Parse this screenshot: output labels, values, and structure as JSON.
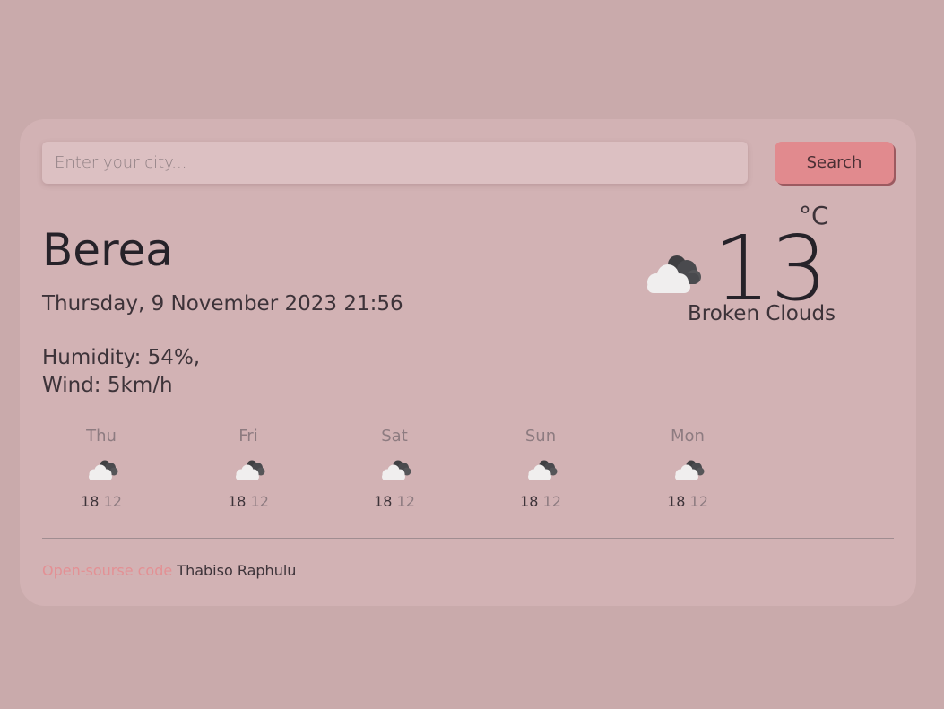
{
  "search": {
    "placeholder": "Enter your city...",
    "value": "",
    "button_label": "Search"
  },
  "current": {
    "city": "Berea",
    "datetime": "Thursday, 9 November 2023 21:56",
    "humidity": "Humidity: 54%,",
    "wind": "Wind: 5km/h",
    "temperature": "13",
    "unit": "°C",
    "description": "Broken Clouds",
    "icon": "broken-clouds-icon"
  },
  "forecast": [
    {
      "day": "Thu",
      "max": "18",
      "min": "12",
      "icon": "broken-clouds-icon"
    },
    {
      "day": "Fri",
      "max": "18",
      "min": "12",
      "icon": "broken-clouds-icon"
    },
    {
      "day": "Sat",
      "max": "18",
      "min": "12",
      "icon": "broken-clouds-icon"
    },
    {
      "day": "Sun",
      "max": "18",
      "min": "12",
      "icon": "broken-clouds-icon"
    },
    {
      "day": "Mon",
      "max": "18",
      "min": "12",
      "icon": "broken-clouds-icon"
    }
  ],
  "footer": {
    "link_text": "Open-sourse code",
    "author": "Thabiso Raphulu"
  },
  "colors": {
    "page_background": "#c9aaab",
    "card_background": "#d2b2b4",
    "accent": "#e18a8e",
    "link": "#e39094"
  }
}
